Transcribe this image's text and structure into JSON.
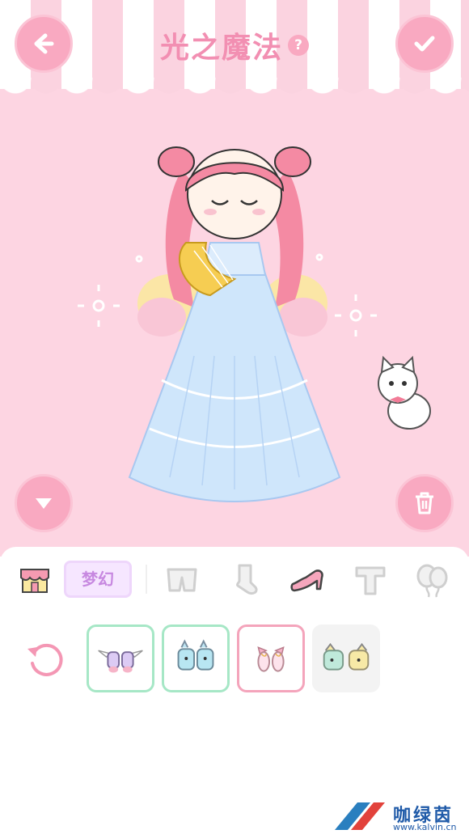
{
  "header": {
    "title": "光之魔法",
    "help_label": "?"
  },
  "icons": {
    "back": "arrow-left-icon",
    "confirm": "checkmark-icon",
    "collapse": "chevron-down-icon",
    "delete": "trash-icon",
    "reset": "reset-icon"
  },
  "categories": {
    "active_label": "梦幻",
    "items": [
      "shop-icon",
      "shorts-icon",
      "sock-icon",
      "high-heel-icon",
      "t-shirt-icon",
      "balloon-icon"
    ],
    "active_item": "high-heel-icon"
  },
  "items": [
    {
      "icon": "winged-shoes-icon",
      "state": "owned"
    },
    {
      "icon": "bunny-boots-icon",
      "state": "owned"
    },
    {
      "icon": "ribbon-slippers-icon",
      "state": "selected"
    },
    {
      "icon": "pastel-boots-icon",
      "state": "locked"
    }
  ],
  "watermark": {
    "text": "咖绿茵",
    "url": "www.kalvin.cn"
  },
  "colors": {
    "accent_pink": "#f9a9c1",
    "stage_bg": "#fdd5e2",
    "title_pink": "#f28fb2",
    "tile_green": "#a6e7c6",
    "tile_pink": "#f4a4bb",
    "label_purple": "#c788e0"
  }
}
